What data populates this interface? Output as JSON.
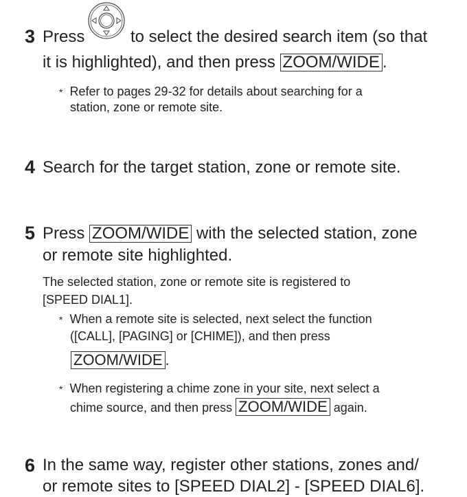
{
  "step3": {
    "number": "3",
    "press": "Press",
    "line1_rest": "to select the desired search item (so that",
    "line2": "it is highlighted), and then press",
    "key": "ZOOM/WIDE",
    "period": ".",
    "note_star": "*",
    "note_line1": "Refer to pages 29-32 for details about searching for a",
    "note_line2": "station, zone or remote site."
  },
  "step4": {
    "number": "4",
    "text": "Search for the target station, zone or remote site."
  },
  "step5": {
    "number": "5",
    "press": "Press",
    "key": "ZOOM/WIDE",
    "line1_rest": "with the selected station, zone",
    "line2": "or remote site highlighted.",
    "result_line1": "The selected station, zone or remote site is registered to",
    "result_line2": "[SPEED DIAL1].",
    "note1_line1": "When a remote site is selected, next select the function",
    "note1_line2": "([CALL], [PAGING] or [CHIME]), and then press",
    "note1_key": "ZOOM/WIDE",
    "note1_period": ".",
    "note2_line1": "When registering a chime zone in your site, next select a",
    "note2_line2_pre": "chime source, and then press",
    "note2_key": "ZOOM/WIDE",
    "note2_line2_post": "again."
  },
  "step6": {
    "number": "6",
    "line1": "In the same way, register other stations, zones and/",
    "line2": "or remote sites to [SPEED DIAL2] - [SPEED DIAL6]."
  },
  "icons": {
    "dpad": "directional-pad-icon"
  }
}
